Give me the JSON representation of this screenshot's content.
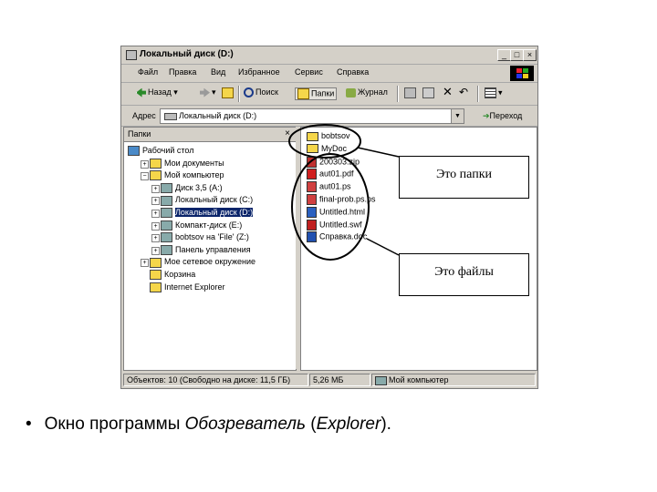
{
  "window": {
    "title": "Локальный диск (D:)",
    "controls": {
      "minimize": "_",
      "maximize": "□",
      "close": "×"
    }
  },
  "menu": {
    "items": [
      "Файл",
      "Правка",
      "Вид",
      "Избранное",
      "Сервис",
      "Справка"
    ]
  },
  "toolbar": {
    "back": "Назад",
    "search": "Поиск",
    "folders": "Папки",
    "journal": "Журнал"
  },
  "address": {
    "label": "Адрес",
    "value": "Локальный диск (D:)",
    "go": "Переход"
  },
  "folders_pane": {
    "title": "Папки",
    "close": "×",
    "tree": [
      {
        "label": "Рабочий стол",
        "level": 0,
        "expander": ""
      },
      {
        "label": "Мои документы",
        "level": 1,
        "expander": "+"
      },
      {
        "label": "Мой компьютер",
        "level": 1,
        "expander": "−"
      },
      {
        "label": "Диск 3,5 (A:)",
        "level": 2,
        "expander": "+"
      },
      {
        "label": "Локальный диск (C:)",
        "level": 2,
        "expander": "+"
      },
      {
        "label": "Локальный диск (D:)",
        "level": 2,
        "expander": "+",
        "selected": true
      },
      {
        "label": "Компакт-диск (E:)",
        "level": 2,
        "expander": "+"
      },
      {
        "label": "bobtsov на 'File' (Z:)",
        "level": 2,
        "expander": "+"
      },
      {
        "label": "Панель управления",
        "level": 2,
        "expander": "+"
      },
      {
        "label": "Мое сетевое окружение",
        "level": 1,
        "expander": "+"
      },
      {
        "label": "Корзина",
        "level": 1,
        "expander": ""
      },
      {
        "label": "Internet Explorer",
        "level": 1,
        "expander": ""
      }
    ]
  },
  "files_pane": {
    "items": [
      {
        "name": "bobtsov",
        "kind": "folder"
      },
      {
        "name": "MyDoc",
        "kind": "folder"
      },
      {
        "name": "200303.zip",
        "kind": "zip"
      },
      {
        "name": "aut01.pdf",
        "kind": "pdf"
      },
      {
        "name": "aut01.ps",
        "kind": "ps"
      },
      {
        "name": "final-prob.ps.ps",
        "kind": "ps"
      },
      {
        "name": "Untitled.html",
        "kind": "html"
      },
      {
        "name": "Untitled.swf",
        "kind": "swf"
      },
      {
        "name": "Справка.doc",
        "kind": "doc"
      }
    ]
  },
  "status": {
    "objects": "Объектов: 10 (Свободно на диске: 11,5 ГБ)",
    "size": "5,26 МБ",
    "location": "Мой компьютер"
  },
  "annotations": {
    "folders_label": "Это папки",
    "files_label": "Это файлы"
  },
  "caption": {
    "bullet": "•",
    "prefix": "Окно программы ",
    "program": "Обозреватель",
    "open_paren": " (",
    "english": "Explorer",
    "close_paren": ")."
  },
  "colors": {
    "chrome": "#d4d0c8",
    "selection": "#0a246a",
    "folder_icon": "#f5d64a"
  }
}
